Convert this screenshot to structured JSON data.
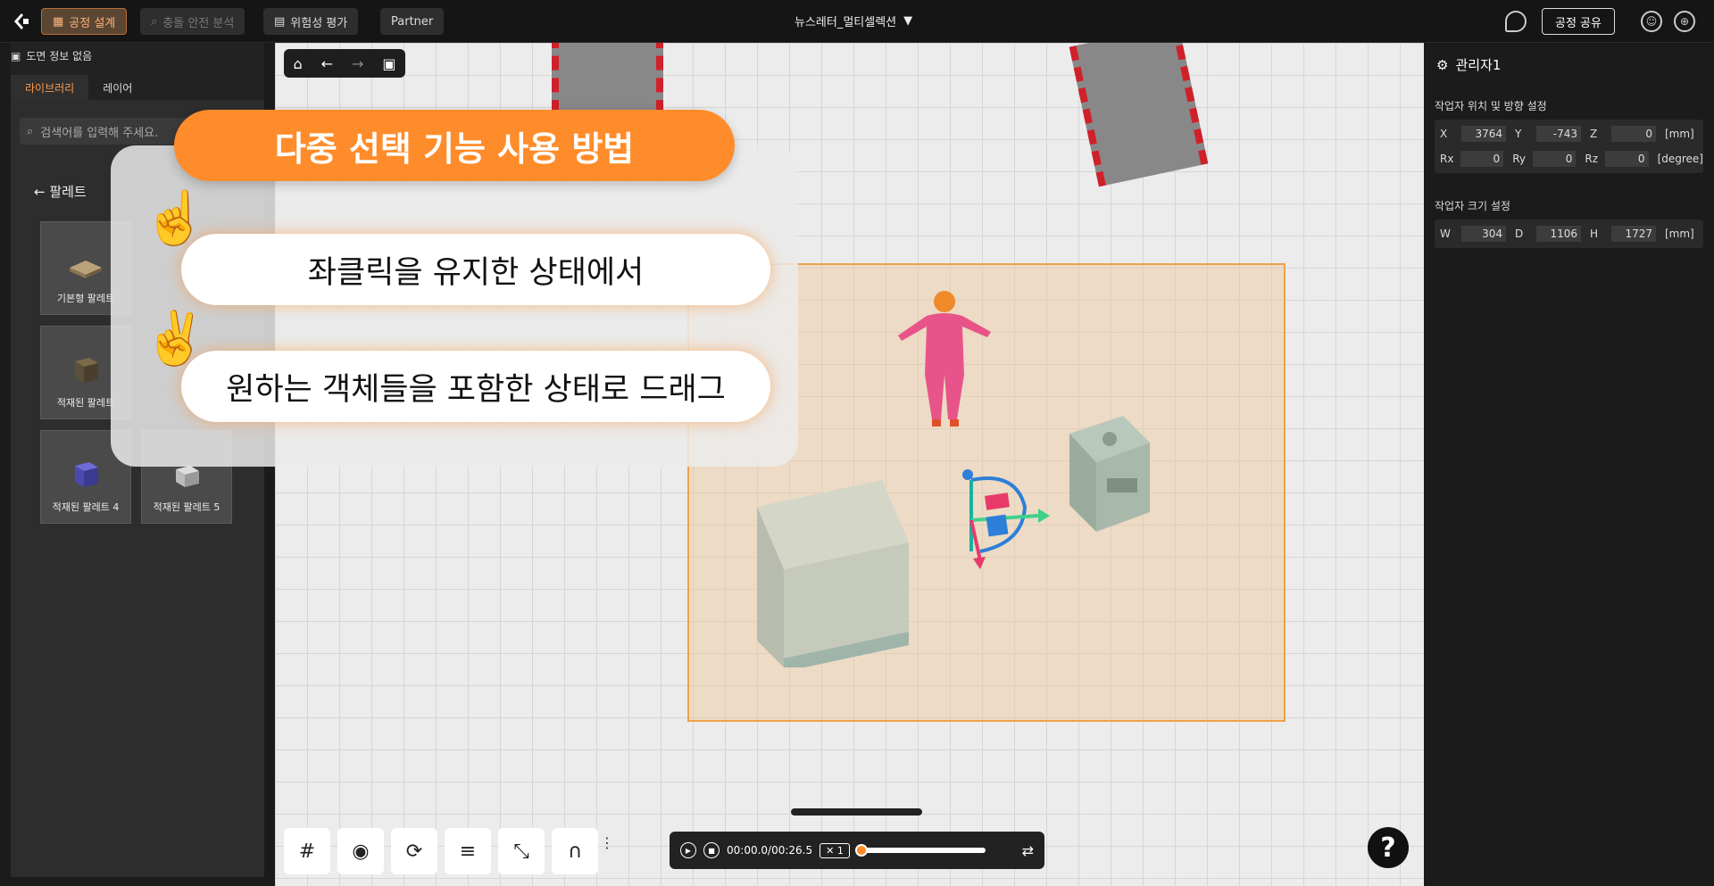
{
  "topbar": {
    "tabs": [
      {
        "label": "공정 설계",
        "icon": "factory-icon"
      },
      {
        "label": "충돌 안전 분석",
        "icon": "magnifier-icon"
      },
      {
        "label": "위험성 평가",
        "icon": "document-icon"
      },
      {
        "label": "Partner"
      }
    ],
    "project_name": "뉴스레터_멀티셀렉션",
    "share_label": "공정 공유"
  },
  "sidebar": {
    "header": "도면 정보 없음",
    "tabs": [
      "라이브러리",
      "레이어"
    ],
    "search_placeholder": "검색어를 입력해 주세요.",
    "back_label": "팔레트",
    "tiles": [
      {
        "label": "기본형 팔레트"
      },
      {
        "label": "적재된 팔레트"
      },
      {
        "label": "적재된 팔레트 4"
      },
      {
        "label": "적재된 팔레트 5"
      }
    ]
  },
  "overlay": {
    "title": "다중 선택 기능 사용 방법",
    "step1": "좌클릭을 유지한 상태에서",
    "step2": "원하는 객체들을 포함한 상태로 드래그",
    "hand1": "☝️",
    "hand2": "✌️"
  },
  "player": {
    "time": "00:00.0/00:26.5",
    "speed": "✕ 1",
    "progress": 0.0
  },
  "right_panel": {
    "title": "관리자1",
    "pos_section": "작업자 위치 및 방향 설정",
    "pos_rows": [
      [
        {
          "l": "X",
          "v": "3764"
        },
        {
          "l": "Y",
          "v": "-743"
        },
        {
          "l": "Z",
          "v": "0"
        }
      ],
      [
        {
          "l": "Rx",
          "v": "0"
        },
        {
          "l": "Ry",
          "v": "0"
        },
        {
          "l": "Rz",
          "v": "0"
        }
      ]
    ],
    "pos_units": [
      "[mm]",
      "[degree]"
    ],
    "size_section": "작업자 크기 설정",
    "size_row": [
      {
        "l": "W",
        "v": "304"
      },
      {
        "l": "D",
        "v": "1106"
      },
      {
        "l": "H",
        "v": "1727"
      }
    ],
    "size_unit": "[mm]"
  },
  "help_label": "?"
}
